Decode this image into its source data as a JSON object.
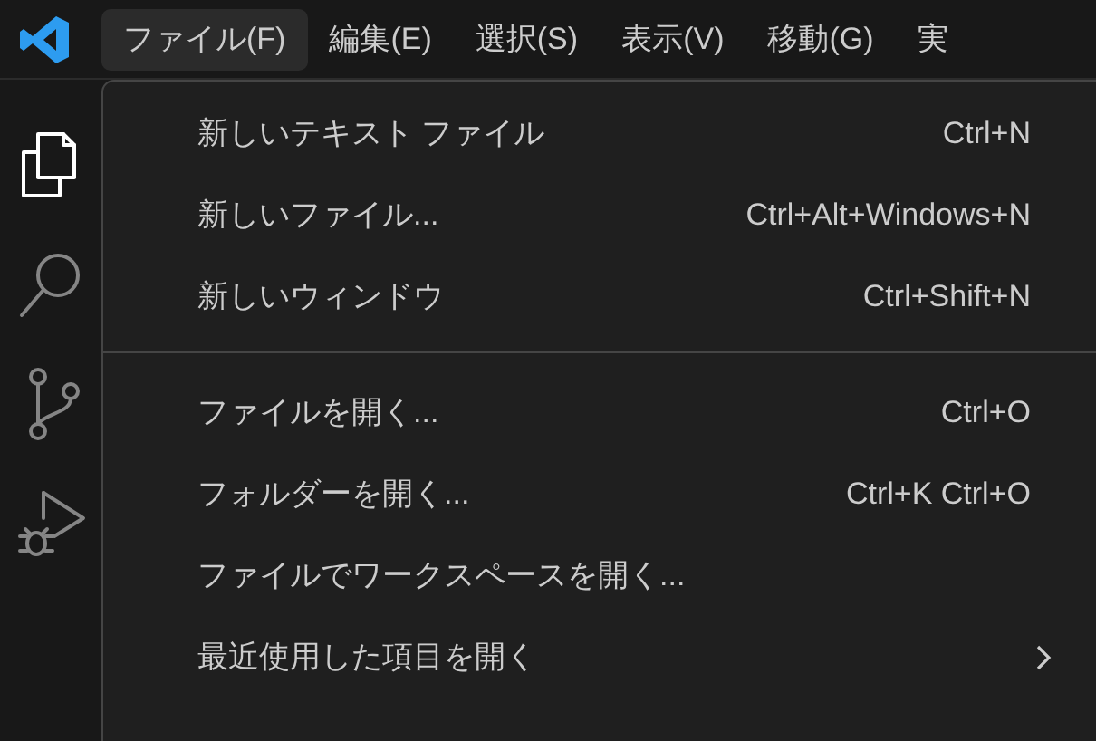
{
  "menubar": [
    {
      "label": "ファイル(F)",
      "selected": true
    },
    {
      "label": "編集(E)",
      "selected": false
    },
    {
      "label": "選択(S)",
      "selected": false
    },
    {
      "label": "表示(V)",
      "selected": false
    },
    {
      "label": "移動(G)",
      "selected": false
    },
    {
      "label": "実",
      "selected": false
    }
  ],
  "activity_bar": [
    {
      "kind": "files",
      "selected": true
    },
    {
      "kind": "search",
      "selected": false
    },
    {
      "kind": "source-control",
      "selected": false
    },
    {
      "kind": "run-debug",
      "selected": false
    }
  ],
  "menu": {
    "groups": [
      [
        {
          "label": "新しいテキスト ファイル",
          "shortcut": "Ctrl+N",
          "kind": "command"
        },
        {
          "label": "新しいファイル...",
          "shortcut": "Ctrl+Alt+Windows+N",
          "kind": "command"
        },
        {
          "label": "新しいウィンドウ",
          "shortcut": "Ctrl+Shift+N",
          "kind": "command"
        }
      ],
      [
        {
          "label": "ファイルを開く...",
          "shortcut": "Ctrl+O",
          "kind": "command"
        },
        {
          "label": "フォルダーを開く...",
          "shortcut": "Ctrl+K Ctrl+O",
          "kind": "command"
        },
        {
          "label": "ファイルでワークスペースを開く...",
          "kind": "command"
        },
        {
          "label": "最近使用した項目を開く",
          "kind": "submenu"
        }
      ]
    ]
  }
}
